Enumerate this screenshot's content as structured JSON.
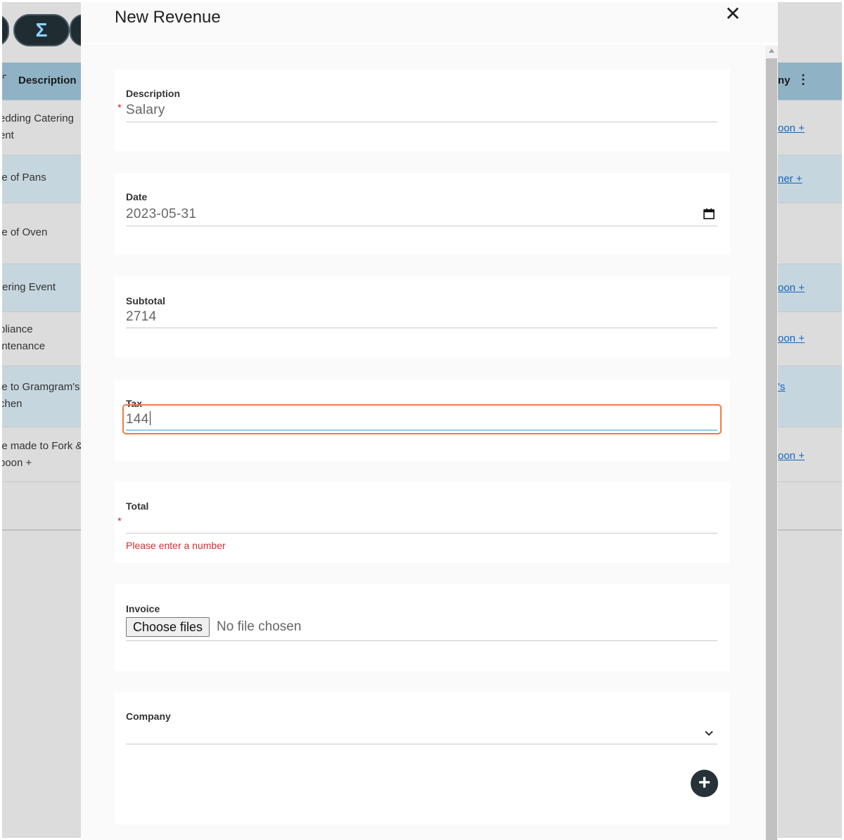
{
  "background": {
    "header": {
      "description_label": "Description",
      "right_label": "ny"
    },
    "rows": [
      {
        "text": "edding Catering\nent",
        "link": "oon +"
      },
      {
        "text": "le of Pans",
        "link": "ner +"
      },
      {
        "text": "le of Oven",
        "link": ""
      },
      {
        "text": "tering Event",
        "link": "oon +"
      },
      {
        "text": "pliance\nintenance",
        "link": "oon +"
      },
      {
        "text": "le to Gramgram's\nchen",
        "link": "'s"
      },
      {
        "text": "le made to Fork &\npoon +",
        "link": "oon +"
      }
    ],
    "sigma_label": "Σ"
  },
  "modal": {
    "title": "New Revenue",
    "close_label": "✕",
    "fields": {
      "description": {
        "label": "Description",
        "value": "Salary",
        "required": "*"
      },
      "date": {
        "label": "Date",
        "value": "2023-05-31",
        "icon": "calendar-icon"
      },
      "subtotal": {
        "label": "Subtotal",
        "value": "2714"
      },
      "tax": {
        "label": "Tax",
        "value": "144"
      },
      "total": {
        "label": "Total",
        "value": "",
        "required": "*",
        "error": "Please enter a number"
      },
      "invoice": {
        "label": "Invoice",
        "button_label": "Choose files",
        "status": "No file chosen"
      },
      "company": {
        "label": "Company",
        "value": "",
        "icon": "chevron-down-icon"
      }
    },
    "add_button_label": "+",
    "colors": {
      "focus": "#ef7a45",
      "error": "#d32f2f",
      "fab": "#263238",
      "header_bg": "#8fb3c4"
    }
  }
}
